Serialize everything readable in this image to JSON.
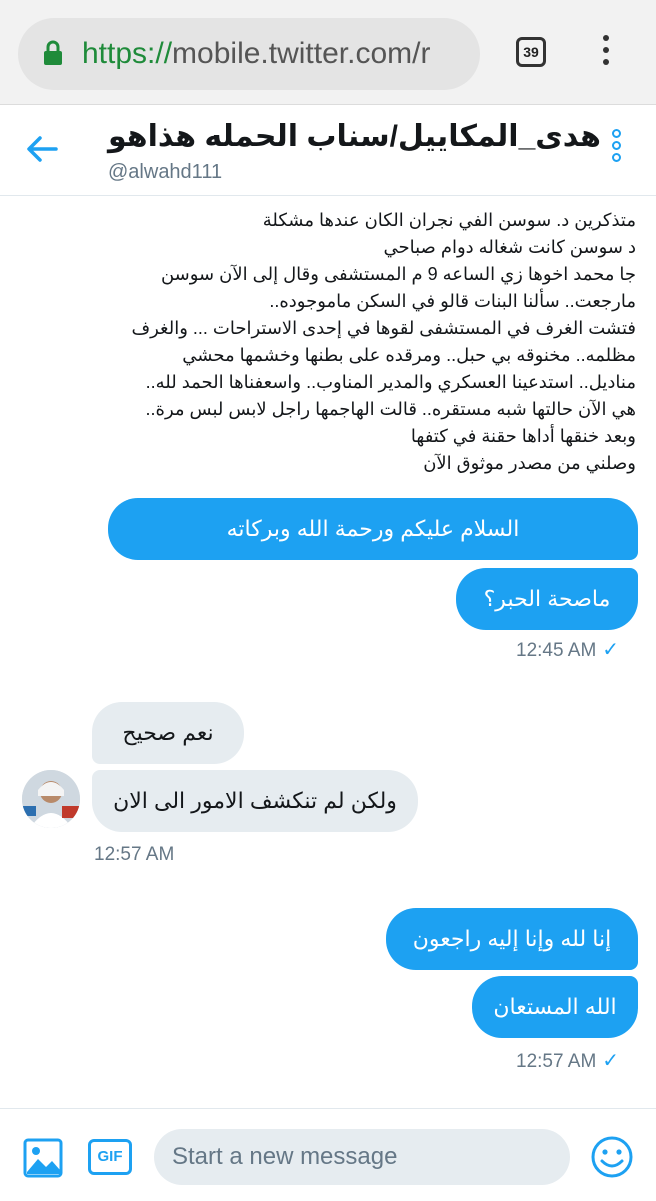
{
  "browser": {
    "url_scheme": "https://",
    "url_rest": "mobile.twitter.com/r",
    "tab_count": "39"
  },
  "header": {
    "title": "هدى_المكاييل/سناب الحمله هذاهو",
    "handle": "@alwahd111"
  },
  "quoted_text": [
    "متذكرين د. سوسن الفي نجران الكان عندها مشكلة",
    "د سوسن كانت شغاله دوام صباحي",
    "جا محمد اخوها زي الساعه 9 م المستشفى وقال إلى الآن سوسن",
    "مارجعت.. سألنا البنات قالو في السكن ماموجوده..",
    "فتشت الغرف في المستشفى لقوها في إحدى الاستراحات ... والغرف",
    "مظلمه.. مخنوقه بي حبل.. ومرقده على بطنها وخشمها محشي",
    "مناديل.. استدعينا العسكري والمدير المناوب.. واسعفناها الحمد لله..",
    "هي الآن حالتها شبه مستقره.. قالت الهاجمها راجل لابس لبس مرة..",
    "وبعد خنقها أداها حقنة في كتفها",
    "وصلني من مصدر موثوق الآن"
  ],
  "messages": {
    "out1": "السلام عليكم ورحمة الله وبركاته",
    "out2": "ماصحة الحبر؟",
    "out_time1": "12:45 AM",
    "in1": "نعم صحيح",
    "in2": "ولكن لم تنكشف الامور الى الان",
    "in_time": "12:57 AM",
    "out3": "إنا لله وإنا إليه راجعون",
    "out4": "الله المستعان",
    "out_time2": "12:57 AM"
  },
  "compose": {
    "placeholder": "Start a new message",
    "gif_label": "GIF"
  },
  "colors": {
    "accent": "#1da1f2",
    "incoming_bubble": "#e6ecf0",
    "secure_green": "#1f8b3a"
  },
  "icons": [
    "lock-icon",
    "kebab-menu-icon",
    "back-arrow-icon",
    "more-options-icon",
    "image-icon",
    "gif-icon",
    "emoji-icon",
    "read-check-icon"
  ]
}
